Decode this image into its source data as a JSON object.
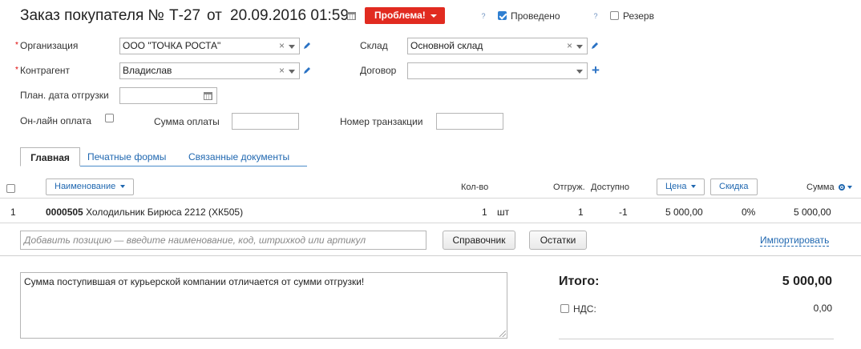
{
  "header": {
    "title": "Заказ покупателя №",
    "number": "Т-27",
    "from_label": "от",
    "date": "20.09.2016 01:59",
    "status": "Проблема!",
    "conducted_help": "?",
    "conducted_label": "Проведено",
    "conducted_checked": true,
    "reserve_help": "?",
    "reserve_label": "Резерв",
    "reserve_checked": false
  },
  "form": {
    "required_mark": "*",
    "organization_label": "Организация",
    "organization_value": "ООО \"ТОЧКА РОСТА\"",
    "warehouse_label": "Склад",
    "warehouse_value": "Основной склад",
    "counterparty_label": "Контрагент",
    "counterparty_value": "Владислав",
    "contract_label": "Договор",
    "contract_value": "",
    "ship_date_label": "План. дата отгрузки",
    "online_payment_label": "Он-лайн оплата",
    "payment_sum_label": "Сумма оплаты",
    "transaction_label": "Номер транзакции",
    "clear_glyph": "×"
  },
  "tabs": [
    {
      "label": "Главная",
      "active": true
    },
    {
      "label": "Печатные формы",
      "active": false
    },
    {
      "label": "Связанные документы",
      "active": false
    }
  ],
  "table": {
    "headers": {
      "name": "Наименование",
      "qty": "Кол-во",
      "shipped": "Отгруж.",
      "available": "Доступно",
      "price": "Цена",
      "discount": "Скидка",
      "sum": "Сумма"
    },
    "rows": [
      {
        "index": "1",
        "code": "0000505",
        "name": "Холодильник Бирюса 2212 (ХК505)",
        "qty": "1",
        "unit": "шт",
        "shipped": "1",
        "available": "-1",
        "price": "5 000,00",
        "discount": "0%",
        "sum": "5 000,00"
      }
    ]
  },
  "add_position": {
    "placeholder": "Добавить позицию — введите наименование, код, штрихкод или артикул",
    "directory_button": "Справочник",
    "stock_button": "Остатки",
    "import_link": "Импортировать"
  },
  "comment": "Сумма поступившая от курьерской компании отличается от сумми отгрузки!",
  "totals": {
    "total_label": "Итого:",
    "total_value": "5 000,00",
    "vat_label": "НДС:",
    "vat_value": "0,00"
  },
  "colors": {
    "status_red": "#e12b20",
    "link_blue": "#1f67b0",
    "checkbox_blue": "#2f7fd1"
  }
}
